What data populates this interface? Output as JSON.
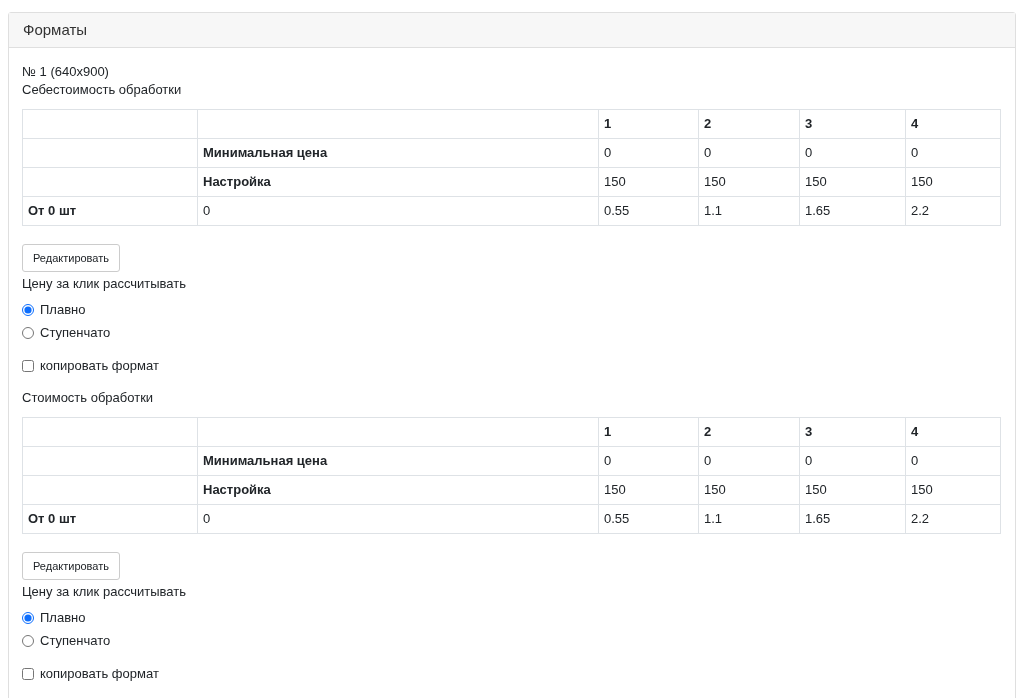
{
  "card": {
    "title": "Форматы"
  },
  "format_label": "№ 1 (640x900)",
  "sections": [
    {
      "title": "Себестоимость обработки",
      "table": {
        "rows": [
          {
            "kind": "header",
            "cells": [
              "",
              "",
              "1",
              "2",
              "3",
              "4"
            ]
          },
          {
            "kind": "param",
            "cells": [
              "",
              "Минимальная цена",
              "0",
              "0",
              "0",
              "0"
            ]
          },
          {
            "kind": "param",
            "cells": [
              "",
              "Настройка",
              "150",
              "150",
              "150",
              "150"
            ]
          },
          {
            "kind": "range",
            "cells": [
              "От 0 шт",
              "0",
              "0.55",
              "1.1",
              "1.65",
              "2.2"
            ]
          }
        ]
      },
      "edit_button": "Редактировать",
      "radio_label": "Цену за клик рассчитывать",
      "radios": [
        {
          "label": "Плавно",
          "selected": true
        },
        {
          "label": "Ступенчато",
          "selected": false
        }
      ],
      "copy_checkbox": {
        "label": "копировать формат",
        "checked": false
      }
    },
    {
      "title": "Стоимость обработки",
      "table": {
        "rows": [
          {
            "kind": "header",
            "cells": [
              "",
              "",
              "1",
              "2",
              "3",
              "4"
            ]
          },
          {
            "kind": "param",
            "cells": [
              "",
              "Минимальная цена",
              "0",
              "0",
              "0",
              "0"
            ]
          },
          {
            "kind": "param",
            "cells": [
              "",
              "Настройка",
              "150",
              "150",
              "150",
              "150"
            ]
          },
          {
            "kind": "range",
            "cells": [
              "От 0 шт",
              "0",
              "0.55",
              "1.1",
              "1.65",
              "2.2"
            ]
          }
        ]
      },
      "edit_button": "Редактировать",
      "radio_label": "Цену за клик рассчитывать",
      "radios": [
        {
          "label": "Плавно",
          "selected": true
        },
        {
          "label": "Ступенчато",
          "selected": false
        }
      ],
      "copy_checkbox": {
        "label": "копировать формат",
        "checked": false
      }
    }
  ]
}
